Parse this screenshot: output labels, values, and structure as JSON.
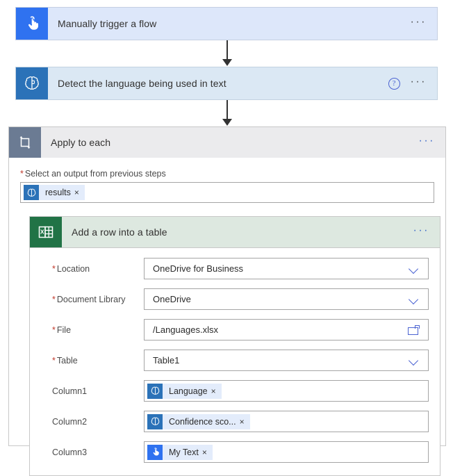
{
  "flow": {
    "trigger": {
      "icon": "touch-hand-icon",
      "title": "Manually trigger a flow",
      "more_label": "···",
      "accent": "#2f72f0",
      "background": "#dde7fa"
    },
    "detect_action": {
      "icon": "brain-icon",
      "title": "Detect the language being used in text",
      "help_label": "?",
      "more_label": "···",
      "accent": "#2b72b8",
      "background": "#dbe8f4"
    },
    "scope": {
      "icon": "loop-icon",
      "title": "Apply to each",
      "more_label": "···",
      "accent": "#6b7b93",
      "header_background": "#ebebed",
      "output_field": {
        "required_marker": "*",
        "label": "Select an output from previous steps",
        "token": {
          "icon": "brain-icon",
          "text": "results",
          "remove_label": "×"
        }
      },
      "excel_action": {
        "icon": "excel-icon",
        "title": "Add a row into a table",
        "more_label": "···",
        "accent": "#217346",
        "header_background": "#dde8e0",
        "fields": [
          {
            "required_marker": "*",
            "label": "Location",
            "value": "OneDrive for Business",
            "control": "dropdown",
            "icon": "chevron-down-icon"
          },
          {
            "required_marker": "*",
            "label": "Document Library",
            "value": "OneDrive",
            "control": "dropdown",
            "icon": "chevron-down-icon"
          },
          {
            "required_marker": "*",
            "label": "File",
            "value": "/Languages.xlsx",
            "control": "file-picker",
            "icon": "folder-icon"
          },
          {
            "required_marker": "*",
            "label": "Table",
            "value": "Table1",
            "control": "dropdown",
            "icon": "chevron-down-icon"
          },
          {
            "required_marker": "",
            "label": "Column1",
            "control": "token",
            "token": {
              "icon": "brain-icon",
              "text": "Language",
              "remove_label": "×",
              "icon_accent": "#2b72b8"
            }
          },
          {
            "required_marker": "",
            "label": "Column2",
            "control": "token",
            "token": {
              "icon": "brain-icon",
              "text": "Confidence sco...",
              "remove_label": "×",
              "icon_accent": "#2b72b8"
            }
          },
          {
            "required_marker": "",
            "label": "Column3",
            "control": "token",
            "token": {
              "icon": "touch-hand-icon",
              "text": "My Text",
              "remove_label": "×",
              "icon_accent": "#2f72f0"
            }
          }
        ]
      }
    }
  }
}
